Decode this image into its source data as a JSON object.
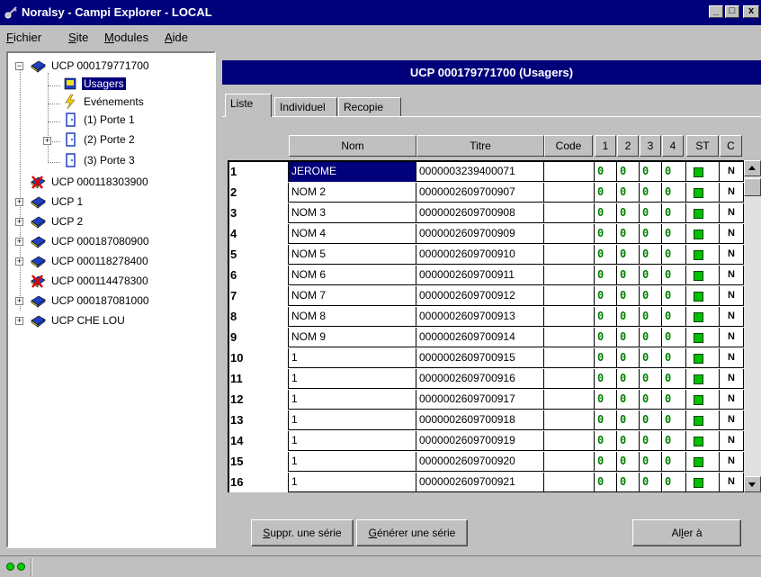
{
  "window": {
    "title": "Noralsy - Campi Explorer - LOCAL",
    "controls": [
      "_",
      "□",
      "x"
    ]
  },
  "menu": [
    {
      "label": "Fichier",
      "key": "F",
      "rest": "ichier"
    },
    {
      "label": "Site",
      "key": "S",
      "rest": "ite"
    },
    {
      "label": "Modules",
      "key": "M",
      "rest": "odules"
    },
    {
      "label": "Aide",
      "key": "A",
      "rest": "ide"
    }
  ],
  "tree": {
    "root": "UCP 000179771700",
    "children": [
      {
        "label": "Usagers",
        "selected": true,
        "icon": "users-icon"
      },
      {
        "label": "Evénements",
        "icon": "lightning-icon"
      },
      {
        "label": "(1) Porte 1",
        "icon": "door-icon"
      },
      {
        "label": "(2) Porte 2",
        "icon": "door-icon"
      },
      {
        "label": "(3) Porte 3",
        "icon": "door-icon"
      }
    ],
    "sites": [
      {
        "label": "UCP 000118303900",
        "status": "error"
      },
      {
        "label": "UCP 1",
        "status": "ok"
      },
      {
        "label": "UCP 2",
        "status": "ok"
      },
      {
        "label": "UCP 000187080900",
        "status": "ok"
      },
      {
        "label": "UCP 000118278400",
        "status": "ok"
      },
      {
        "label": "UCP 000114478300",
        "status": "error"
      },
      {
        "label": "UCP 000187081000",
        "status": "ok"
      },
      {
        "label": "UCP CHE LOU",
        "status": "ok"
      }
    ]
  },
  "panel": {
    "title": "UCP 000179771700 (Usagers)",
    "tabs": [
      "Liste",
      "Individuel",
      "Recopie"
    ],
    "active_tab": "Liste"
  },
  "grid": {
    "headers": {
      "nom": "Nom",
      "titre": "Titre",
      "code": "Code",
      "c1": "1",
      "c2": "2",
      "c3": "3",
      "c4": "4",
      "st": "ST",
      "c": "C"
    },
    "rows": [
      {
        "n": "1",
        "nom": "JEROME",
        "titre": "0000003239400071",
        "code": "",
        "z1": "0",
        "z2": "0",
        "z3": "0",
        "z4": "0",
        "c": "N"
      },
      {
        "n": "2",
        "nom": "NOM 2",
        "titre": "0000002609700907",
        "code": "",
        "z1": "0",
        "z2": "0",
        "z3": "0",
        "z4": "0",
        "c": "N"
      },
      {
        "n": "3",
        "nom": "NOM 3",
        "titre": "0000002609700908",
        "code": "",
        "z1": "0",
        "z2": "0",
        "z3": "0",
        "z4": "0",
        "c": "N"
      },
      {
        "n": "4",
        "nom": "NOM 4",
        "titre": "0000002609700909",
        "code": "",
        "z1": "0",
        "z2": "0",
        "z3": "0",
        "z4": "0",
        "c": "N"
      },
      {
        "n": "5",
        "nom": "NOM 5",
        "titre": "0000002609700910",
        "code": "",
        "z1": "0",
        "z2": "0",
        "z3": "0",
        "z4": "0",
        "c": "N"
      },
      {
        "n": "6",
        "nom": "NOM 6",
        "titre": "0000002609700911",
        "code": "",
        "z1": "0",
        "z2": "0",
        "z3": "0",
        "z4": "0",
        "c": "N"
      },
      {
        "n": "7",
        "nom": "NOM 7",
        "titre": "0000002609700912",
        "code": "",
        "z1": "0",
        "z2": "0",
        "z3": "0",
        "z4": "0",
        "c": "N"
      },
      {
        "n": "8",
        "nom": "NOM 8",
        "titre": "0000002609700913",
        "code": "",
        "z1": "0",
        "z2": "0",
        "z3": "0",
        "z4": "0",
        "c": "N"
      },
      {
        "n": "9",
        "nom": "NOM 9",
        "titre": "0000002609700914",
        "code": "",
        "z1": "0",
        "z2": "0",
        "z3": "0",
        "z4": "0",
        "c": "N"
      },
      {
        "n": "10",
        "nom": "1",
        "titre": "0000002609700915",
        "code": "",
        "z1": "0",
        "z2": "0",
        "z3": "0",
        "z4": "0",
        "c": "N"
      },
      {
        "n": "11",
        "nom": "1",
        "titre": "0000002609700916",
        "code": "",
        "z1": "0",
        "z2": "0",
        "z3": "0",
        "z4": "0",
        "c": "N"
      },
      {
        "n": "12",
        "nom": "1",
        "titre": "0000002609700917",
        "code": "",
        "z1": "0",
        "z2": "0",
        "z3": "0",
        "z4": "0",
        "c": "N"
      },
      {
        "n": "13",
        "nom": "1",
        "titre": "0000002609700918",
        "code": "",
        "z1": "0",
        "z2": "0",
        "z3": "0",
        "z4": "0",
        "c": "N"
      },
      {
        "n": "14",
        "nom": "1",
        "titre": "0000002609700919",
        "code": "",
        "z1": "0",
        "z2": "0",
        "z3": "0",
        "z4": "0",
        "c": "N"
      },
      {
        "n": "15",
        "nom": "1",
        "titre": "0000002609700920",
        "code": "",
        "z1": "0",
        "z2": "0",
        "z3": "0",
        "z4": "0",
        "c": "N"
      },
      {
        "n": "16",
        "nom": "1",
        "titre": "0000002609700921",
        "code": "",
        "z1": "0",
        "z2": "0",
        "z3": "0",
        "z4": "0",
        "c": "N"
      }
    ]
  },
  "buttons": {
    "suppr": {
      "key": "S",
      "rest": "uppr. une série"
    },
    "generer": {
      "key": "G",
      "rest": "énérer une série"
    },
    "aller": {
      "pre": "Al",
      "key": "l",
      "rest": "er à"
    }
  },
  "colors": {
    "title_bg": "#00007b",
    "zero_green": "#008000",
    "st_green": "#00c000"
  }
}
